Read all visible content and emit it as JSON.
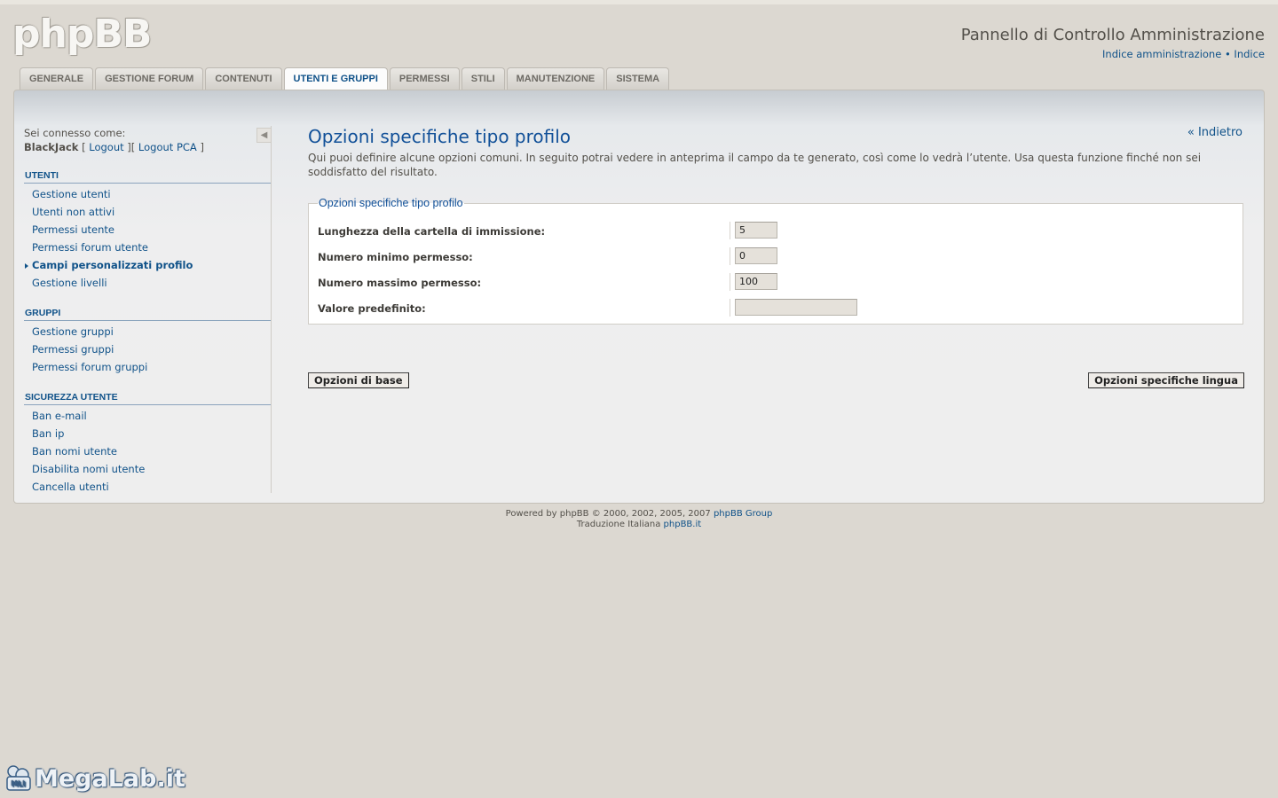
{
  "header": {
    "logo_text": "phpBB",
    "admin_title": "Pannello di Controllo Amministrazione",
    "link_admin_index": "Indice amministrazione",
    "link_separator": "•",
    "link_index": "Indice"
  },
  "tabs": [
    {
      "label": "GENERALE",
      "active": false
    },
    {
      "label": "GESTIONE FORUM",
      "active": false
    },
    {
      "label": "CONTENUTI",
      "active": false
    },
    {
      "label": "UTENTI E GRUPPI",
      "active": true
    },
    {
      "label": "PERMESSI",
      "active": false
    },
    {
      "label": "STILI",
      "active": false
    },
    {
      "label": "MANUTENZIONE",
      "active": false
    },
    {
      "label": "SISTEMA",
      "active": false
    }
  ],
  "sidebar": {
    "logged_in_label": "Sei connesso come:",
    "username": "BlackJack",
    "logout_label": "Logout",
    "logout_pca_label": "Logout PCA",
    "sections": [
      {
        "title": "UTENTI",
        "items": [
          {
            "label": "Gestione utenti",
            "active": false
          },
          {
            "label": "Utenti non attivi",
            "active": false
          },
          {
            "label": "Permessi utente",
            "active": false
          },
          {
            "label": "Permessi forum utente",
            "active": false
          },
          {
            "label": "Campi personalizzati profilo",
            "active": true
          },
          {
            "label": "Gestione livelli",
            "active": false
          }
        ]
      },
      {
        "title": "GRUPPI",
        "items": [
          {
            "label": "Gestione gruppi",
            "active": false
          },
          {
            "label": "Permessi gruppi",
            "active": false
          },
          {
            "label": "Permessi forum gruppi",
            "active": false
          }
        ]
      },
      {
        "title": "SICUREZZA UTENTE",
        "items": [
          {
            "label": "Ban e-mail",
            "active": false
          },
          {
            "label": "Ban ip",
            "active": false
          },
          {
            "label": "Ban nomi utente",
            "active": false
          },
          {
            "label": "Disabilita nomi utente",
            "active": false
          },
          {
            "label": "Cancella utenti",
            "active": false
          }
        ]
      }
    ]
  },
  "main": {
    "title": "Opzioni specifiche tipo profilo",
    "back_link": "« Indietro",
    "description": "Qui puoi definire alcune opzioni comuni. In seguito potrai vedere in anteprima il campo da te generato, così come lo vedrà l’utente. Usa questa funzione finché non sei soddisfatto del risultato.",
    "fieldset_legend": "Opzioni specifiche tipo profilo",
    "fields": [
      {
        "label": "Lunghezza della cartella di immissione:",
        "value": "5"
      },
      {
        "label": "Numero minimo permesso:",
        "value": "0"
      },
      {
        "label": "Numero massimo permesso:",
        "value": "100"
      },
      {
        "label": "Valore predefinito:",
        "value": ""
      }
    ],
    "btn_basic": "Opzioni di base",
    "btn_language": "Opzioni specifiche lingua"
  },
  "footer": {
    "line1_prefix": "Powered by phpBB © 2000, 2002, 2005, 2007",
    "line1_link": "phpBB Group",
    "line2_prefix": "Traduzione Italiana",
    "line2_link": "phpBB.it"
  },
  "watermark": {
    "icon_text": "MLI",
    "text": "MegaLab.it"
  },
  "colors": {
    "background": "#dcd8d1",
    "link": "#105289",
    "title": "#115098"
  }
}
